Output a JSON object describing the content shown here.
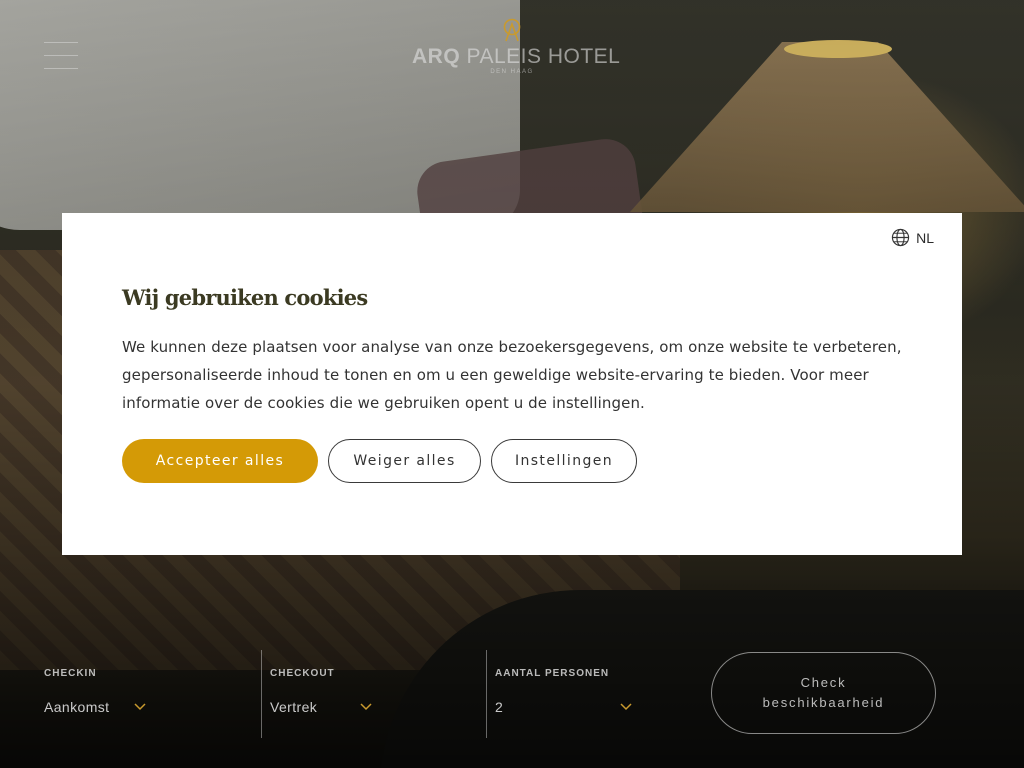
{
  "header": {
    "logo_name_bold": "ARQ",
    "logo_name_light": " PALEIS HOTEL",
    "logo_sub": "DEN HAAG"
  },
  "cookie": {
    "language": "NL",
    "title": "Wij gebruiken cookies",
    "body": "We kunnen deze plaatsen voor analyse van onze bezoekersgegevens, om onze website te verbeteren, gepersonaliseerde inhoud te tonen en om u een geweldige website-ervaring te bieden. Voor meer informatie over de cookies die we gebruiken opent u de instellingen.",
    "accept_label": "Accepteer alles",
    "reject_label": "Weiger alles",
    "settings_label": "Instellingen"
  },
  "booking": {
    "checkin_label": "CHECKIN",
    "checkin_value": "Aankomst",
    "checkout_label": "CHECKOUT",
    "checkout_value": "Vertrek",
    "guests_label": "AANTAL PERSONEN",
    "guests_value": "2",
    "check_label": "Check beschikbaarheid"
  },
  "colors": {
    "accent": "#d49a06",
    "title": "#3b3a22"
  },
  "icons": [
    "menu-icon",
    "logo-mark-icon",
    "globe-icon",
    "chevron-down-icon"
  ]
}
